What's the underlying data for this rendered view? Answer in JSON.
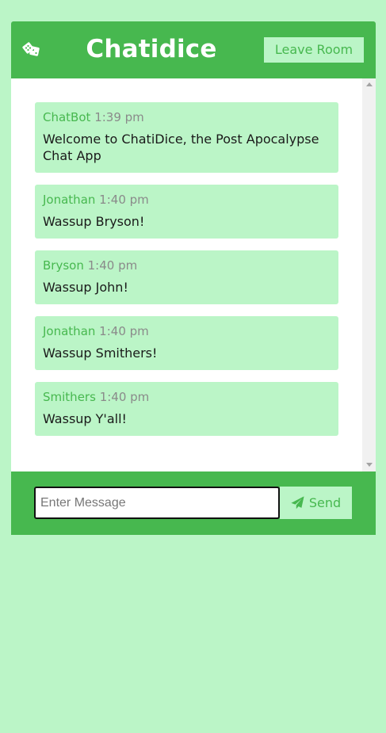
{
  "colors": {
    "page_background": "#bbf5c7",
    "accent": "#47b84f",
    "message_bubble": "#bbf5c7",
    "timestamp": "#8a8a8a"
  },
  "header": {
    "icon": "dice-icon",
    "title": "Chatidice",
    "leave_button_label": "Leave Room"
  },
  "messages": [
    {
      "author": "ChatBot",
      "time": "1:39 pm",
      "text": "Welcome to ChatiDice, the Post Apocalypse Chat App"
    },
    {
      "author": "Jonathan",
      "time": "1:40 pm",
      "text": "Wassup Bryson!"
    },
    {
      "author": "Bryson",
      "time": "1:40 pm",
      "text": "Wassup John!"
    },
    {
      "author": "Jonathan",
      "time": "1:40 pm",
      "text": "Wassup Smithers!"
    },
    {
      "author": "Smithers",
      "time": "1:40 pm",
      "text": "Wassup Y'all!"
    }
  ],
  "composer": {
    "input_value": "",
    "input_placeholder": "Enter Message",
    "send_icon": "paper-plane-icon",
    "send_label": "Send"
  }
}
